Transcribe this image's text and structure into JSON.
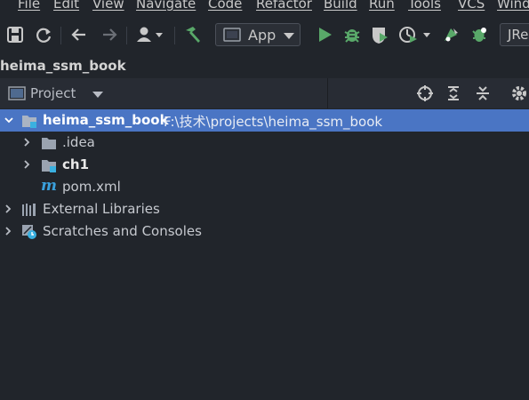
{
  "menu": {
    "items": [
      {
        "label": "File"
      },
      {
        "label": "Edit"
      },
      {
        "label": "View"
      },
      {
        "label": "Navigate"
      },
      {
        "label": "Code"
      },
      {
        "label": "Refactor"
      },
      {
        "label": "Build"
      },
      {
        "label": "Run"
      },
      {
        "label": "Tools"
      },
      {
        "label": "VCS"
      },
      {
        "label": "Wind"
      }
    ]
  },
  "toolbar": {
    "run_config_label": "App",
    "jre_label": "JRe",
    "icons": [
      "save-icon",
      "sync-icon",
      "back-arrow-icon",
      "forward-arrow-icon",
      "user-icon",
      "build-hammer-icon",
      "run-config-icon",
      "run-icon",
      "debug-icon",
      "coverage-icon",
      "profile-icon",
      "update-icon",
      "deploy-icon"
    ]
  },
  "breadcrumb": {
    "project": "heima_ssm_book"
  },
  "project_panel": {
    "title": "Project",
    "header_icons": [
      "locate-icon",
      "expand-all-icon",
      "collapse-all-icon",
      "settings-icon"
    ]
  },
  "tree": {
    "root": {
      "name": "heima_ssm_book",
      "path": "F:\\技术\\projects\\heima_ssm_book"
    },
    "children": [
      {
        "name": ".idea"
      },
      {
        "name": "ch1"
      },
      {
        "name": "pom.xml"
      }
    ],
    "external": "External Libraries",
    "scratches": "Scratches and Consoles"
  },
  "colors": {
    "background": "#21252b",
    "selection": "#4a75c4",
    "run_green": "#59a869",
    "text": "#c6c9cf"
  }
}
